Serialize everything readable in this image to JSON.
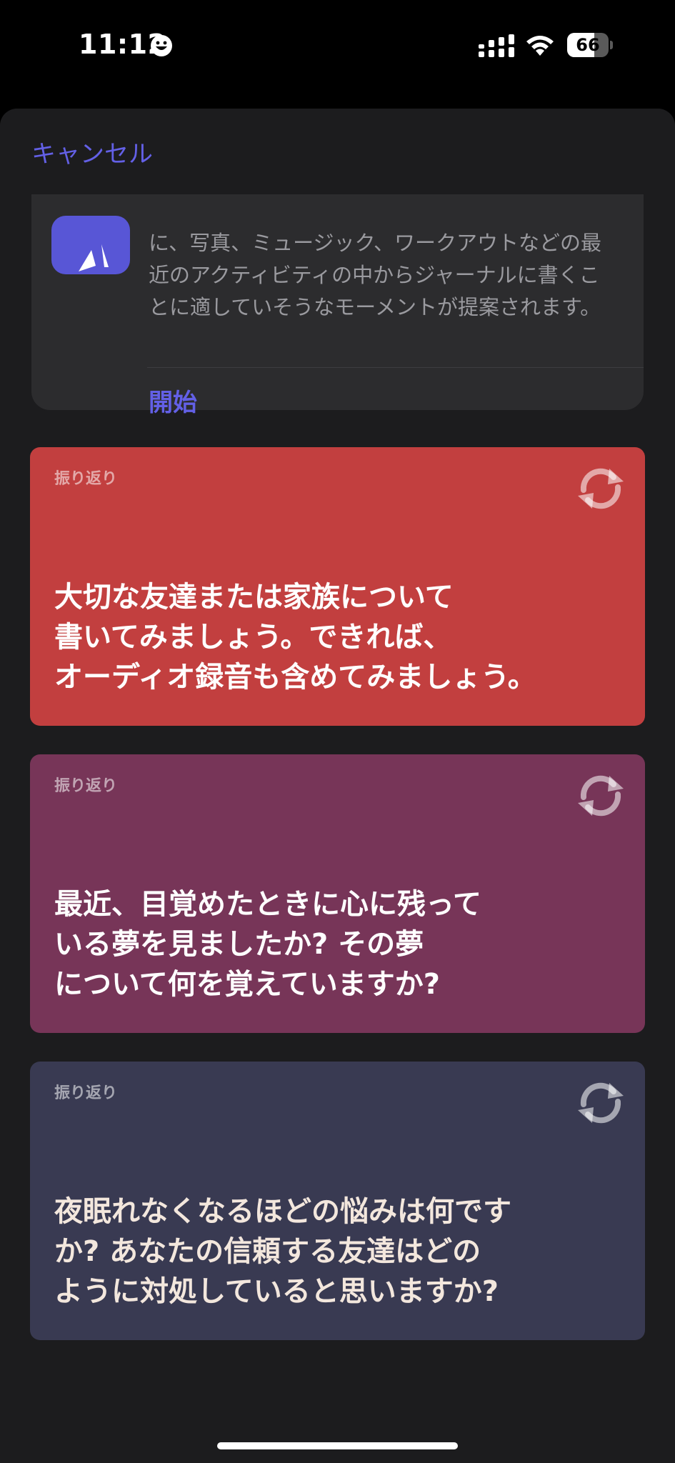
{
  "status_bar": {
    "time": "11:12",
    "battery": "66",
    "battery_level": 0.66
  },
  "header": {
    "cancel_label": "キャンセル"
  },
  "suggestion_card": {
    "text": "に、写真、ミュージック、ワークアウトなどの最近のアクティビティの中からジャーナルに書くことに適していそうなモーメントが提案されます。",
    "start_label": "開始"
  },
  "prompts": [
    {
      "category": "振り返り",
      "text": "大切な友達または家族について\n書いてみましょう。できれば、\nオーディオ録音も含めてみましょう。",
      "color": "#c23f3f"
    },
    {
      "category": "振り返り",
      "text": "最近、目覚めたときに心に残って\nいる夢を見ましたか? その夢\nについて何を覚えていますか?",
      "color": "#773558"
    },
    {
      "category": "振り返り",
      "text": "夜眠れなくなるほどの悩みは何です\nか? あなたの信頼する友達はどの\nように対処していると思いますか?",
      "color": "#393a52"
    }
  ],
  "colors": {
    "accent": "#6360e6",
    "sheet_background": "#1c1c1e",
    "card_background": "#2c2c2e"
  }
}
